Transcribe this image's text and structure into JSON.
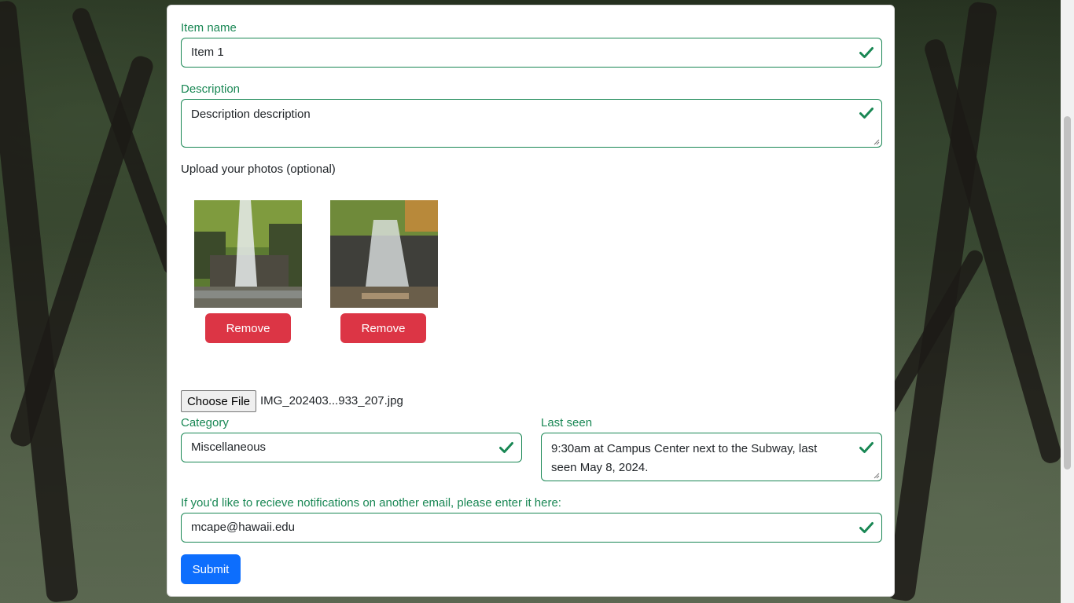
{
  "form": {
    "item_name": {
      "label": "Item name",
      "value": "Item 1"
    },
    "description": {
      "label": "Description",
      "value": "Description description"
    },
    "photos": {
      "label": "Upload your photos (optional)",
      "remove_label": "Remove",
      "count": 2
    },
    "file_input": {
      "button_label": "Choose File",
      "file_name": "IMG_202403...933_207.jpg"
    },
    "category": {
      "label": "Category",
      "value": "Miscellaneous"
    },
    "last_seen": {
      "label": "Last seen",
      "value_line1": "9:30am at Campus Center next to the Subway, last",
      "value_line2": "seen May 8, 2024."
    },
    "email": {
      "label": "If you'd like to recieve notifications on another email, please enter it here:",
      "value": "mcape@hawaii.edu"
    },
    "submit_label": "Submit"
  },
  "colors": {
    "valid": "#198754",
    "danger": "#dc3545",
    "primary": "#0d6efd"
  },
  "icons": {
    "valid": "check-icon"
  }
}
